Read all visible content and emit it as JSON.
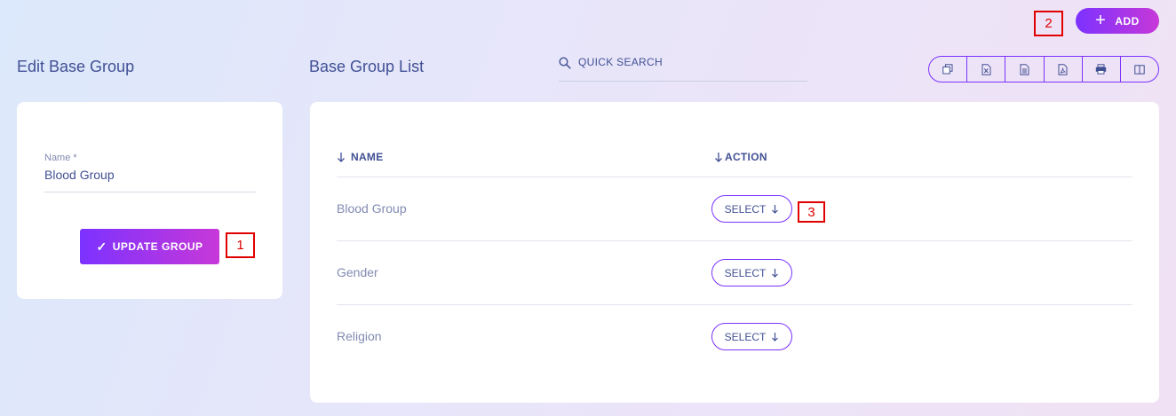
{
  "header": {
    "add_label": "ADD"
  },
  "edit_panel": {
    "title": "Edit Base Group",
    "name_label": "Name *",
    "name_value": "Blood Group",
    "update_label": "UPDATE GROUP"
  },
  "list_panel": {
    "title": "Base Group List",
    "search_placeholder": "QUICK SEARCH",
    "columns": {
      "name": "NAME",
      "action": "ACTION"
    },
    "rows": [
      {
        "name": "Blood Group",
        "action": "SELECT"
      },
      {
        "name": "Gender",
        "action": "SELECT"
      },
      {
        "name": "Religion",
        "action": "SELECT"
      }
    ],
    "toolbar_icons": [
      "copy-icon",
      "excel-icon",
      "csv-icon",
      "pdf-icon",
      "print-icon",
      "columns-icon"
    ]
  },
  "markers": {
    "m1": "1",
    "m2": "2",
    "m3": "3"
  },
  "colors": {
    "accent": "#7c32ff",
    "accent_end": "#c738d8",
    "text": "#415094",
    "muted": "#828bb2",
    "marker": "#e00000"
  }
}
